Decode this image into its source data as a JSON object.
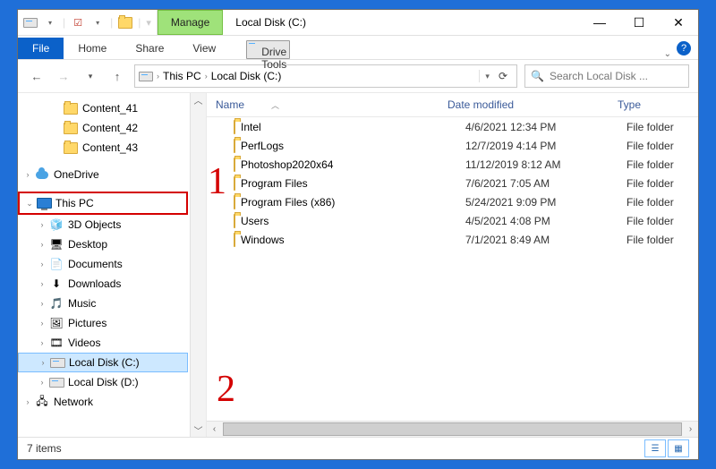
{
  "title": "Local Disk (C:)",
  "context_tab_group": "Manage",
  "context_tab": "Drive Tools",
  "ribbon": {
    "file": "File",
    "home": "Home",
    "share": "Share",
    "view": "View"
  },
  "breadcrumb": {
    "seg1": "This PC",
    "seg2": "Local Disk (C:)"
  },
  "search": {
    "placeholder": "Search Local Disk ..."
  },
  "headers": {
    "name": "Name",
    "date": "Date modified",
    "type": "Type"
  },
  "nav": {
    "folders": [
      {
        "label": "Content_41"
      },
      {
        "label": "Content_42"
      },
      {
        "label": "Content_43"
      }
    ],
    "onedrive": "OneDrive",
    "thispc": "This PC",
    "children": [
      {
        "label": "3D Objects",
        "icon": "cube"
      },
      {
        "label": "Desktop",
        "icon": "desktop"
      },
      {
        "label": "Documents",
        "icon": "doc"
      },
      {
        "label": "Downloads",
        "icon": "down"
      },
      {
        "label": "Music",
        "icon": "music"
      },
      {
        "label": "Pictures",
        "icon": "pic"
      },
      {
        "label": "Videos",
        "icon": "vid"
      },
      {
        "label": "Local Disk (C:)",
        "icon": "drive",
        "selected": true
      },
      {
        "label": "Local Disk (D:)",
        "icon": "drive"
      }
    ],
    "network": "Network"
  },
  "files": [
    {
      "name": "Intel",
      "date": "4/6/2021 12:34 PM",
      "type": "File folder"
    },
    {
      "name": "PerfLogs",
      "date": "12/7/2019 4:14 PM",
      "type": "File folder"
    },
    {
      "name": "Photoshop2020x64",
      "date": "11/12/2019 8:12 AM",
      "type": "File folder"
    },
    {
      "name": "Program Files",
      "date": "7/6/2021 7:05 AM",
      "type": "File folder"
    },
    {
      "name": "Program Files (x86)",
      "date": "5/24/2021 9:09 PM",
      "type": "File folder"
    },
    {
      "name": "Users",
      "date": "4/5/2021 4:08 PM",
      "type": "File folder"
    },
    {
      "name": "Windows",
      "date": "7/1/2021 8:49 AM",
      "type": "File folder"
    }
  ],
  "status": "7 items",
  "annotations": {
    "one": "1",
    "two": "2"
  }
}
